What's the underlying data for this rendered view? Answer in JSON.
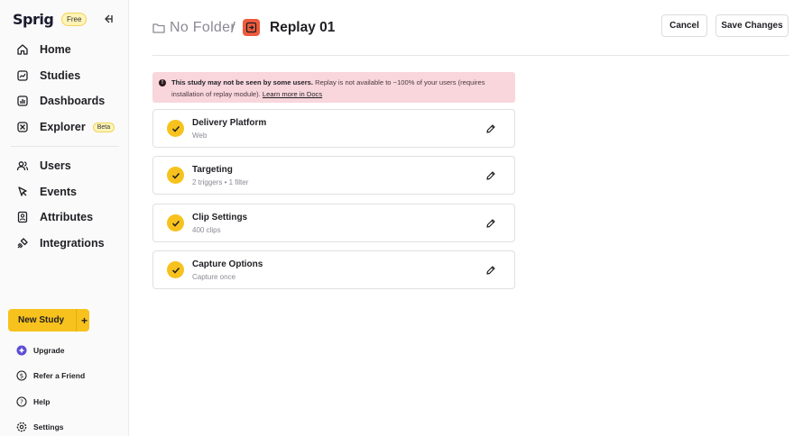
{
  "app": {
    "logo": "Sprig",
    "plan_badge": "Free"
  },
  "sidebar": {
    "primary": [
      {
        "label": "Home",
        "icon": "home-icon"
      },
      {
        "label": "Studies",
        "icon": "studies-icon"
      },
      {
        "label": "Dashboards",
        "icon": "dashboards-icon"
      },
      {
        "label": "Explorer",
        "icon": "explorer-icon",
        "badge": "Beta"
      }
    ],
    "secondary": [
      {
        "label": "Users",
        "icon": "users-icon"
      },
      {
        "label": "Events",
        "icon": "events-icon"
      },
      {
        "label": "Attributes",
        "icon": "attributes-icon"
      },
      {
        "label": "Integrations",
        "icon": "integrations-icon"
      }
    ],
    "new_study_label": "New Study",
    "bottom": [
      {
        "label": "Upgrade",
        "icon": "upgrade-icon"
      },
      {
        "label": "Refer a Friend",
        "icon": "refer-icon"
      },
      {
        "label": "Help",
        "icon": "help-icon"
      },
      {
        "label": "Settings",
        "icon": "settings-icon"
      }
    ]
  },
  "header": {
    "folder_label": "No Folder",
    "separator": "/",
    "study_title": "Replay 01",
    "cancel_label": "Cancel",
    "save_label": "Save Changes"
  },
  "warning": {
    "bold_text": "This study may not be seen by some users.",
    "body_text": " Replay is not available to ~100% of your users (requires installation of replay module). ",
    "link_text": "Learn more in Docs"
  },
  "cards": [
    {
      "title": "Delivery Platform",
      "subtitle": "Web"
    },
    {
      "title": "Targeting",
      "subtitle": "2 triggers • 1 filter"
    },
    {
      "title": "Clip Settings",
      "subtitle": "400 clips"
    },
    {
      "title": "Capture Options",
      "subtitle": "Capture once"
    }
  ],
  "colors": {
    "accent_yellow": "#f7c21d",
    "study_icon_red": "#ef5b3c",
    "warning_bg": "#f8d6dc",
    "upgrade_purple": "#5b4bd6"
  }
}
